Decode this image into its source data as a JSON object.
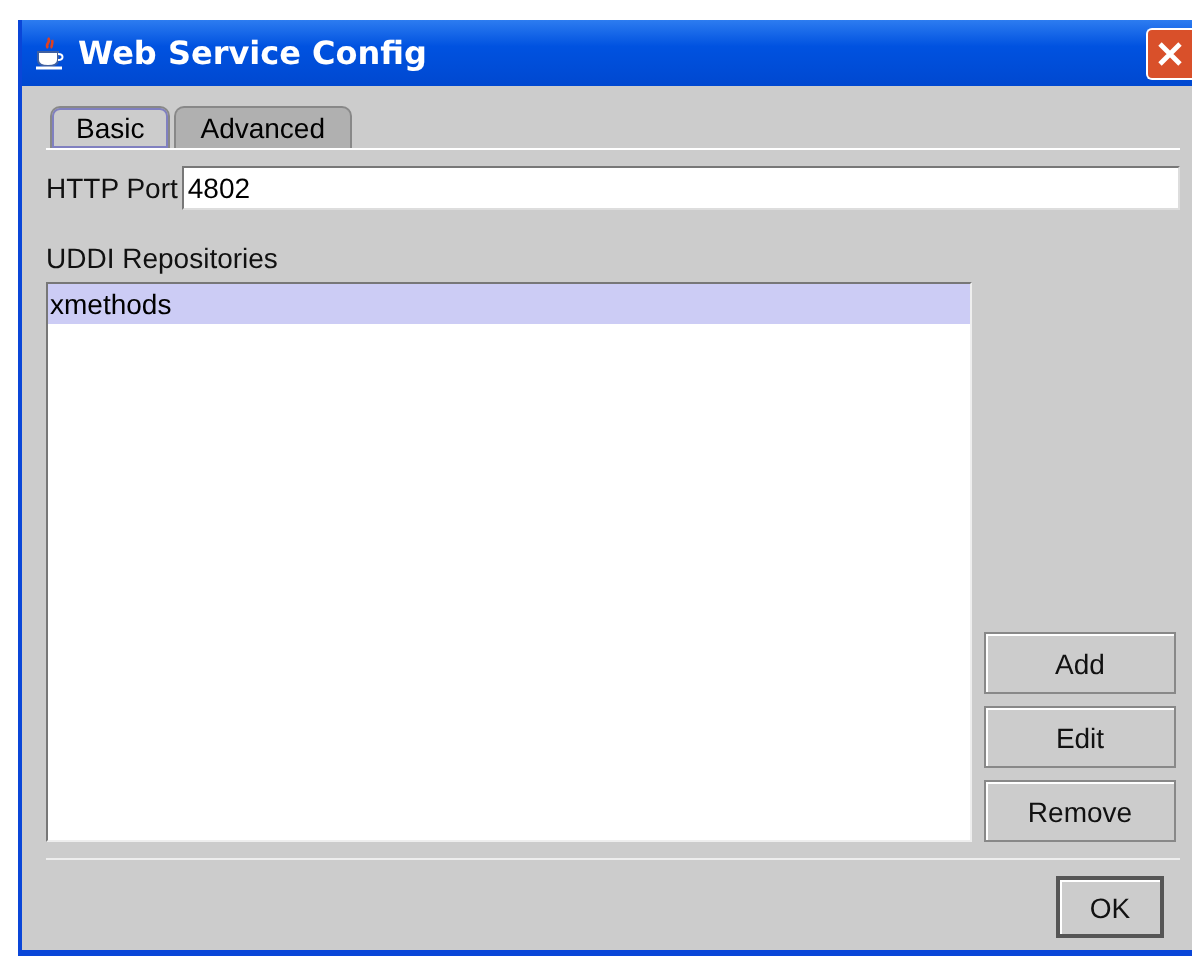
{
  "window": {
    "title": "Web Service Config"
  },
  "tabs": [
    {
      "label": "Basic",
      "selected": true
    },
    {
      "label": "Advanced",
      "selected": false
    }
  ],
  "http_port": {
    "label": "HTTP Port",
    "value": "4802"
  },
  "repositories": {
    "label": "UDDI Repositories",
    "items": [
      {
        "name": "xmethods",
        "selected": true
      }
    ]
  },
  "side_buttons": [
    "Add",
    "Edit",
    "Remove"
  ],
  "buttons": [
    "OK"
  ]
}
